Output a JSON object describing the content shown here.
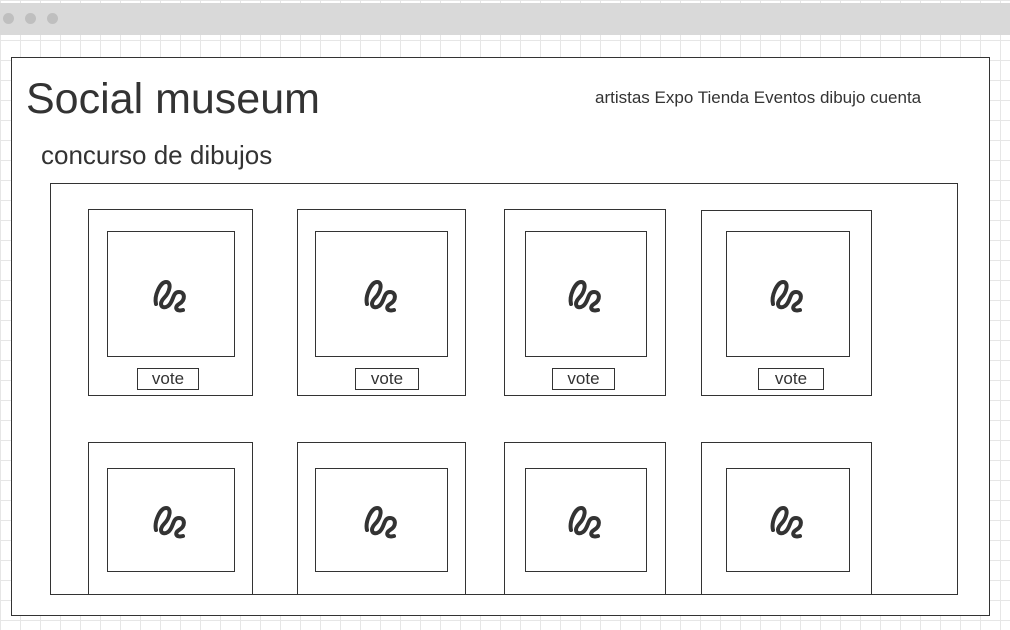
{
  "header": {
    "title": "Social museum",
    "nav": [
      "artistas",
      "Expo",
      "Tienda",
      "Eventos",
      "dibujo",
      "cuenta"
    ]
  },
  "section": {
    "title": "concurso de dibujos"
  },
  "cards": [
    {
      "image_icon": "image-placeholder-icon",
      "vote_label": "vote"
    },
    {
      "image_icon": "image-placeholder-icon",
      "vote_label": "vote"
    },
    {
      "image_icon": "image-placeholder-icon",
      "vote_label": "vote"
    },
    {
      "image_icon": "image-placeholder-icon",
      "vote_label": "vote"
    },
    {
      "image_icon": "image-placeholder-icon"
    },
    {
      "image_icon": "image-placeholder-icon"
    },
    {
      "image_icon": "image-placeholder-icon"
    },
    {
      "image_icon": "image-placeholder-icon"
    }
  ]
}
